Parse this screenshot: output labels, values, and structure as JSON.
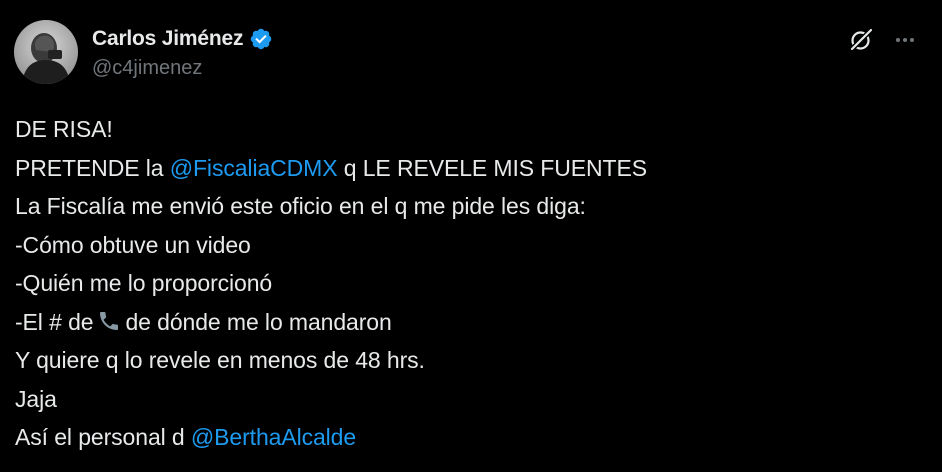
{
  "author": {
    "display_name": "Carlos Jiménez",
    "handle": "@c4jimenez",
    "verified": true
  },
  "icons": {
    "verified": "verified-badge-icon",
    "grok": "grok-icon",
    "more": "more-horizontal-icon",
    "phone": "telephone-receiver-emoji"
  },
  "colors": {
    "background": "#000000",
    "text": "#e7e9ea",
    "secondary": "#71767b",
    "link": "#1d9bf0",
    "verified": "#1d9bf0"
  },
  "tweet": {
    "line1": "DE RISA!",
    "line2_pre": "PRETENDE la ",
    "line2_mention": "@FiscaliaCDMX",
    "line2_post": " q LE REVELE MIS FUENTES",
    "line3": "La Fiscalía me envió este oficio en el q me pide les diga:",
    "line4": "-Cómo obtuve un video",
    "line5": "-Quién me lo proporcionó",
    "line6_pre": "-El # de",
    "line6_post": "de dónde me lo mandaron",
    "line7": "Y quiere q lo revele en menos de 48 hrs.",
    "line8": "Jaja",
    "line9_pre": "Así el personal d ",
    "line9_mention": "@BerthaAlcalde"
  }
}
